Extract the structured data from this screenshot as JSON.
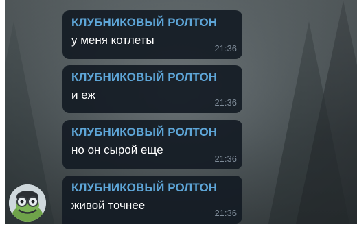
{
  "chat": {
    "messages": [
      {
        "sender": "КЛУБНИКОВЫЙ РОЛТОН",
        "text": "у меня котлеты",
        "time": "21:36"
      },
      {
        "sender": "КЛУБНИКОВЫЙ РОЛТОН",
        "text": "и еж",
        "time": "21:36"
      },
      {
        "sender": "КЛУБНИКОВЫЙ РОЛТОН",
        "text": "но он сырой еще",
        "time": "21:36"
      },
      {
        "sender": "КЛУБНИКОВЫЙ РОЛТОН",
        "text": "живой точнее",
        "time": "21:36"
      }
    ],
    "avatar_icon": "crazy-frog-avatar",
    "colors": {
      "bubble": "#141b24",
      "sender": "#5ea6d8",
      "message_text": "#ffffff",
      "time": "#7d8a97"
    }
  }
}
